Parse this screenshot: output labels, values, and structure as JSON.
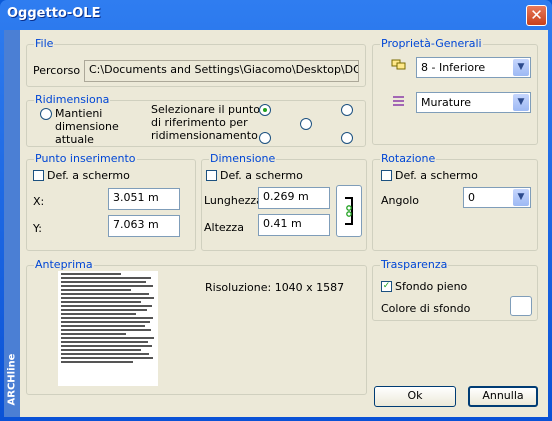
{
  "window": {
    "title": "Oggetto-OLE",
    "sidebar_label": "ARCHline"
  },
  "file": {
    "caption": "File",
    "path_label": "Percorso",
    "path_value": "C:\\Documents and Settings\\Giacomo\\Desktop\\DOC VARI\\T"
  },
  "proprieta": {
    "caption": "Proprietà-Generali",
    "layer_value": "8 - Inferiore",
    "material_value": "Murature"
  },
  "ridimensiona": {
    "caption": "Ridimensiona",
    "keep_label": "Mantieni dimensione attuale",
    "select_point_label": "Selezionare il punto di riferimento per ridimensionamento"
  },
  "punto": {
    "caption": "Punto inserimento",
    "def_label": "Def. a schermo",
    "x_label": "X:",
    "x_value": "3.051 m",
    "y_label": "Y:",
    "y_value": "7.063 m"
  },
  "dimensione": {
    "caption": "Dimensione",
    "def_label": "Def. a schermo",
    "length_label": "Lunghezza",
    "length_value": "0.269 m",
    "height_label": "Altezza",
    "height_value": "0.41 m"
  },
  "rotazione": {
    "caption": "Rotazione",
    "def_label": "Def. a schermo",
    "angle_label": "Angolo",
    "angle_value": "0"
  },
  "anteprima": {
    "caption": "Anteprima",
    "resolution": "Risoluzione: 1040 x 1587"
  },
  "trasparenza": {
    "caption": "Trasparenza",
    "solid_label": "Sfondo pieno",
    "bg_color_label": "Colore di sfondo",
    "bg_color": "#ffffff"
  },
  "buttons": {
    "ok": "Ok",
    "cancel": "Annulla"
  }
}
